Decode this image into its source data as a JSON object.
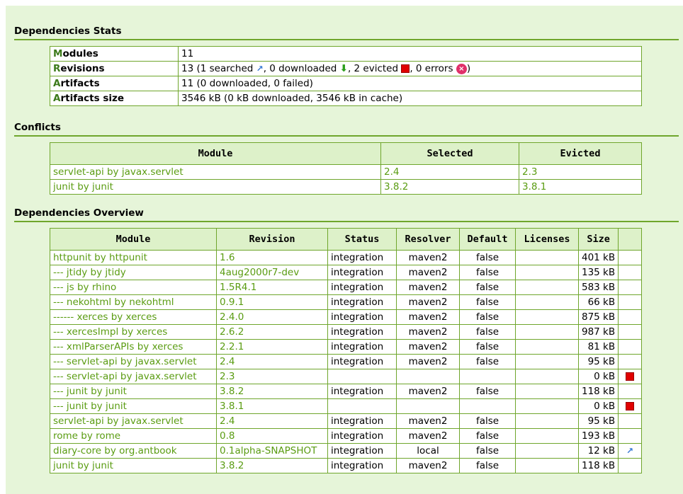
{
  "stats": {
    "title": "Dependencies Stats",
    "modules_label_cap": "M",
    "modules_label_rest": "odules",
    "modules_value": "11",
    "revisions_label_cap": "R",
    "revisions_label_rest": "evisions",
    "rev_part1": "13 (1 searched ",
    "rev_part2": ", 0 downloaded ",
    "rev_part3": ", 2 evicted ",
    "rev_part4": ", 0 errors ",
    "rev_part5": ")",
    "artifacts_label_cap": "A",
    "artifacts_label_rest": "rtifacts",
    "artifacts_value": "11 (0 downloaded, 0 failed)",
    "size_label_cap": "A",
    "size_label_rest": "rtifacts size",
    "size_value": "3546 kB (0 kB downloaded, 3546 kB in cache)"
  },
  "conflicts": {
    "title": "Conflicts",
    "headers": [
      "Module",
      "Selected",
      "Evicted"
    ],
    "rows": [
      {
        "module": "servlet-api by javax.servlet",
        "selected": "2.4",
        "evicted": "2.3"
      },
      {
        "module": "junit by junit",
        "selected": "3.8.2",
        "evicted": "3.8.1"
      }
    ]
  },
  "overview": {
    "title": "Dependencies Overview",
    "headers": [
      "Module",
      "Revision",
      "Status",
      "Resolver",
      "Default",
      "Licenses",
      "Size",
      ""
    ],
    "rows": [
      {
        "module": "httpunit by httpunit",
        "revision": "1.6",
        "status": "integration",
        "resolver": "maven2",
        "default": "false",
        "licenses": "",
        "size": "401 kB",
        "icon": ""
      },
      {
        "module": "--- jtidy by jtidy",
        "revision": "4aug2000r7-dev",
        "status": "integration",
        "resolver": "maven2",
        "default": "false",
        "licenses": "",
        "size": "135 kB",
        "icon": ""
      },
      {
        "module": "--- js by rhino",
        "revision": "1.5R4.1",
        "status": "integration",
        "resolver": "maven2",
        "default": "false",
        "licenses": "",
        "size": "583 kB",
        "icon": ""
      },
      {
        "module": "--- nekohtml by nekohtml",
        "revision": "0.9.1",
        "status": "integration",
        "resolver": "maven2",
        "default": "false",
        "licenses": "",
        "size": "66 kB",
        "icon": ""
      },
      {
        "module": "------ xerces by xerces",
        "revision": "2.4.0",
        "status": "integration",
        "resolver": "maven2",
        "default": "false",
        "licenses": "",
        "size": "875 kB",
        "icon": ""
      },
      {
        "module": "--- xercesImpl by xerces",
        "revision": "2.6.2",
        "status": "integration",
        "resolver": "maven2",
        "default": "false",
        "licenses": "",
        "size": "987 kB",
        "icon": ""
      },
      {
        "module": "--- xmlParserAPIs by xerces",
        "revision": "2.2.1",
        "status": "integration",
        "resolver": "maven2",
        "default": "false",
        "licenses": "",
        "size": "81 kB",
        "icon": ""
      },
      {
        "module": "--- servlet-api by javax.servlet",
        "revision": "2.4",
        "status": "integration",
        "resolver": "maven2",
        "default": "false",
        "licenses": "",
        "size": "95 kB",
        "icon": ""
      },
      {
        "module": "--- servlet-api by javax.servlet",
        "revision": "2.3",
        "status": "",
        "resolver": "",
        "default": "",
        "licenses": "",
        "size": "0 kB",
        "icon": "evicted"
      },
      {
        "module": "--- junit by junit",
        "revision": "3.8.2",
        "status": "integration",
        "resolver": "maven2",
        "default": "false",
        "licenses": "",
        "size": "118 kB",
        "icon": ""
      },
      {
        "module": "--- junit by junit",
        "revision": "3.8.1",
        "status": "",
        "resolver": "",
        "default": "",
        "licenses": "",
        "size": "0 kB",
        "icon": "evicted"
      },
      {
        "module": "servlet-api by javax.servlet",
        "revision": "2.4",
        "status": "integration",
        "resolver": "maven2",
        "default": "false",
        "licenses": "",
        "size": "95 kB",
        "icon": ""
      },
      {
        "module": "rome by rome",
        "revision": "0.8",
        "status": "integration",
        "resolver": "maven2",
        "default": "false",
        "licenses": "",
        "size": "193 kB",
        "icon": ""
      },
      {
        "module": "diary-core by org.antbook",
        "revision": "0.1alpha-SNAPSHOT",
        "status": "integration",
        "resolver": "local",
        "default": "false",
        "licenses": "",
        "size": "12 kB",
        "icon": "searched"
      },
      {
        "module": "junit by junit",
        "revision": "3.8.2",
        "status": "integration",
        "resolver": "maven2",
        "default": "false",
        "licenses": "",
        "size": "118 kB",
        "icon": ""
      }
    ]
  },
  "icons": {
    "searched": "search-icon",
    "downloaded": "download-arrow-icon",
    "evicted": "evicted-icon",
    "error": "error-icon",
    "searched_glyph": "↗",
    "downloaded_glyph": "⬇",
    "error_glyph": "×"
  },
  "colors": {
    "background": "#e6f5d9",
    "border": "#6fa62c",
    "link": "#5a9c12",
    "header": "#ddf1c9",
    "evicted": "#e00000"
  }
}
